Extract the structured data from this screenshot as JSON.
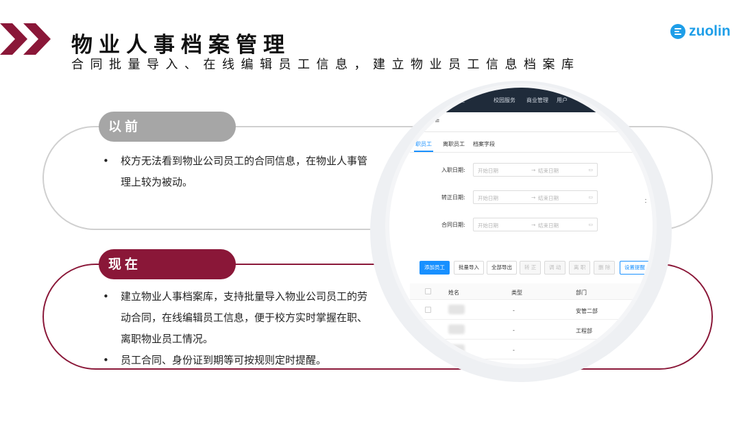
{
  "header": {
    "title": "物业人事档案管理",
    "subtitle": "合同批量导入、在线编辑员工信息，建立物业员工信息档案库",
    "logo_text": "zuolin"
  },
  "colors": {
    "brand_maroon": "#8a1738",
    "badge_grey": "#a6a6a6",
    "logo_blue": "#1e9ee8",
    "link_blue": "#1890ff"
  },
  "before": {
    "label": "以前",
    "bullets": [
      "校方无法看到物业公司员工的合同信息，在物业人事管理上较为被动。"
    ]
  },
  "now": {
    "label": "现在",
    "bullets": [
      "建立物业人事档案库，支持批量导入物业公司员工的劳动合同，在线编辑员工信息，便于校方实时掌握在职、离职物业员工情况。",
      "员工合同、身份证到期等可按规则定时提醒。"
    ]
  },
  "screenshot": {
    "top_nav": [
      "业管理",
      "校园服务",
      "商业管理",
      "用户"
    ],
    "tabs": [
      "职员工",
      "离职员工",
      "档案字段"
    ],
    "filters": [
      {
        "label": "入职日期:",
        "start_placeholder": "开始日期",
        "end_placeholder": "结束日期"
      },
      {
        "label": "转正日期:",
        "start_placeholder": "开始日期",
        "end_placeholder": "结束日期"
      },
      {
        "label": "合同日期:",
        "start_placeholder": "开始日期",
        "end_placeholder": "结束日期"
      }
    ],
    "side_colon": "：",
    "arrow": "→",
    "buttons": [
      "添加员工",
      "批量导入",
      "全部导出",
      "转 正",
      "调 动",
      "离 职",
      "删 除",
      "设置提醒"
    ],
    "columns": [
      "姓名",
      "类型",
      "部门"
    ],
    "rows": [
      {
        "type": "-",
        "department": "安管二部"
      },
      {
        "type": "-",
        "department": "工程部"
      },
      {
        "type": "-",
        "department": ""
      }
    ]
  }
}
